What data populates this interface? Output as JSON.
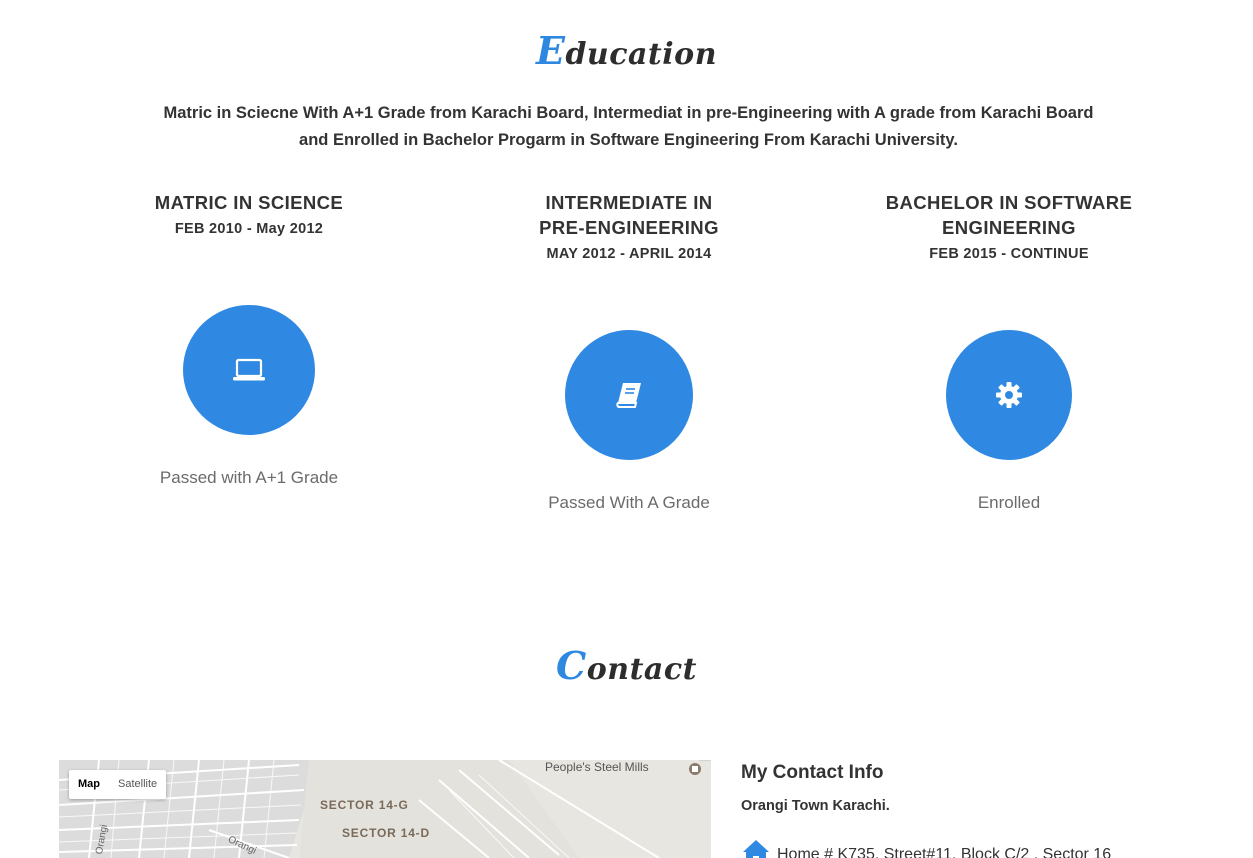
{
  "education": {
    "title_initial": "E",
    "title_rest": "ducation",
    "intro": "Matric in Sciecne With A+1 Grade from Karachi Board, Intermediat in pre-Engineering with A grade from Karachi Board and Enrolled in Bachelor Progarm in Software Engineering From Karachi University.",
    "items": [
      {
        "title": "MATRIC IN SCIENCE",
        "dates": "FEB 2010 - May 2012",
        "icon": "laptop-icon",
        "result": "Passed with A+1 Grade"
      },
      {
        "title": "INTERMEDIATE IN PRE-ENGINEERING",
        "dates": "MAY 2012 - APRIL 2014",
        "icon": "book-icon",
        "result": "Passed With A Grade"
      },
      {
        "title": "BACHELOR IN SOFTWARE ENGINEERING",
        "dates": "FEB 2015 - CONTINUE",
        "icon": "gear-icon",
        "result": "Enrolled"
      }
    ],
    "accent_color": "#2f89e3"
  },
  "contact": {
    "title_initial": "C",
    "title_rest": "ontact",
    "map": {
      "type_buttons": [
        "Map",
        "Satellite"
      ],
      "selected": "Map",
      "labels": [
        "SECTOR 14-G",
        "SECTOR 14-D"
      ],
      "poi": "People's Steel Mills",
      "road_labels": [
        "Orangi",
        "Orangi"
      ]
    },
    "info_heading": "My Contact Info",
    "town": "Orangi Town Karachi.",
    "address": "Home # K735, Street#11, Block C/2 , Sector 16",
    "address_icon": "home-icon"
  }
}
